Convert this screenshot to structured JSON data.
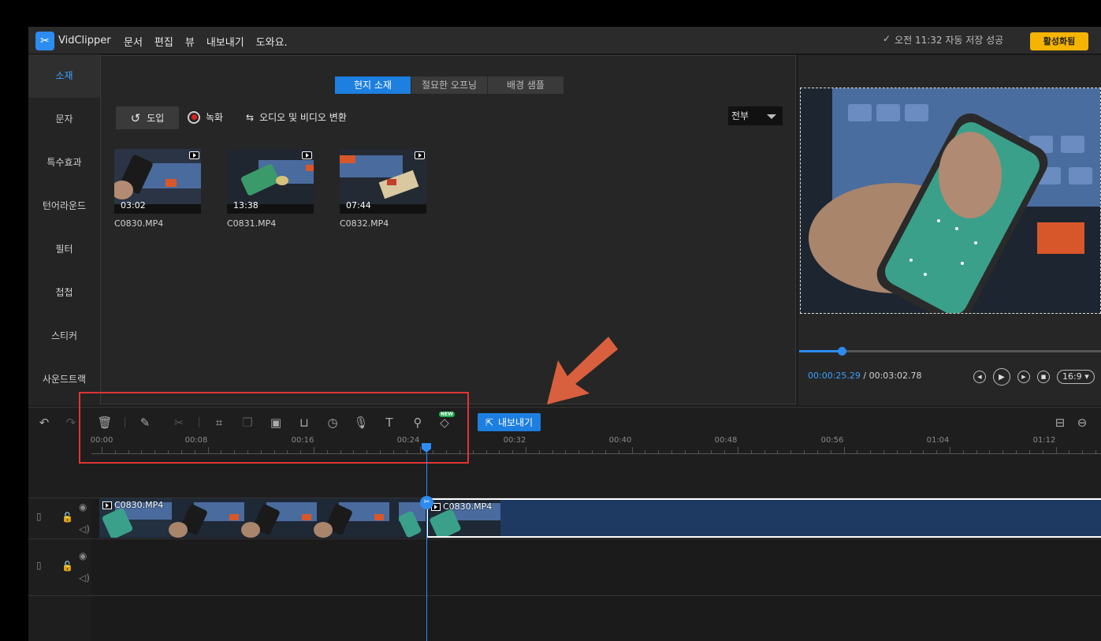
{
  "app": {
    "name": "VidClipper",
    "logo_glyph": "✂"
  },
  "menu": [
    "문서",
    "편집",
    "뷰",
    "내보내기",
    "도와요."
  ],
  "autosave": "오전 11:32 자동 저장 성공",
  "activate_label": "활성화됨",
  "sidebar": [
    "소재",
    "문자",
    "특수효과",
    "턴어라운드",
    "필터",
    "첩첩",
    "스티커",
    "사운드트랙"
  ],
  "media": {
    "tabs": [
      "현지 소재",
      "절묘한 오프닝",
      "배경 샘플"
    ],
    "import_label": "도입",
    "record_label": "녹화",
    "convert_label": "오디오 및 비디오 변환",
    "filter_value": "전부",
    "clips": [
      {
        "name": "C0830.MP4",
        "duration": "03:02"
      },
      {
        "name": "C0831.MP4",
        "duration": "13:38"
      },
      {
        "name": "C0832.MP4",
        "duration": "07:44"
      }
    ]
  },
  "preview": {
    "current_time": "00:00:25.29",
    "total_time": "/ 00:03:02.78",
    "ratio": "16:9",
    "progress_fraction": 0.14
  },
  "toolbar": {
    "export_label": "내보내기",
    "new_badge": "NEW"
  },
  "ruler": [
    "00:00",
    "00:08",
    "00:16",
    "00:24",
    "00:32",
    "00:40",
    "00:48",
    "00:56",
    "01:04",
    "01:12"
  ],
  "timeline": {
    "clips": [
      {
        "name": "C0830.MP4"
      },
      {
        "name": "C0830.MP4"
      }
    ]
  },
  "colors": {
    "accent": "#1d7fe0",
    "activate": "#f5b400",
    "arrow": "#d9603e",
    "highlight": "#e03535"
  }
}
